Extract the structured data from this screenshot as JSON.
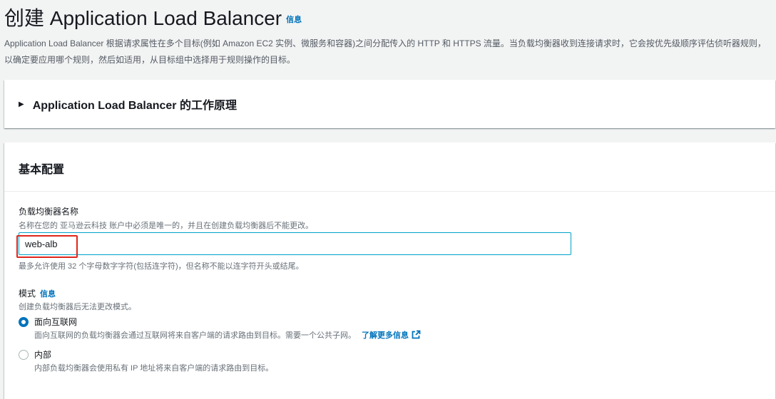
{
  "header": {
    "title": "创建 Application Load Balancer",
    "info_link": "信息",
    "description": "Application Load Balancer 根据请求属性在多个目标(例如 Amazon EC2 实例、微服务和容器)之间分配传入的 HTTP 和 HTTPS 流量。当负载均衡器收到连接请求时，它会按优先级顺序评估侦听器规则，以确定要应用哪个规则，然后如适用，从目标组中选择用于规则操作的目标。"
  },
  "how_it_works": {
    "title": "Application Load Balancer 的工作原理",
    "caret_icon": "caret-right-icon"
  },
  "basic_config": {
    "title": "基本配置",
    "name_field": {
      "label": "负载均衡器名称",
      "description": "名称在您的 亚马逊云科技 账户中必须是唯一的，并且在创建负载均衡器后不能更改。",
      "value": "web-alb",
      "constraint": "最多允许使用 32 个字母数字字符(包括连字符)，但名称不能以连字符开头或结尾。",
      "highlight_color": "#e0261b"
    },
    "scheme": {
      "label": "模式",
      "info_link": "信息",
      "description": "创建负载均衡器后无法更改模式。",
      "options": [
        {
          "label": "面向互联网",
          "description": "面向互联网的负载均衡器会通过互联网将来自客户端的请求路由到目标。需要一个公共子网。",
          "learn_more": "了解更多信息",
          "selected": true
        },
        {
          "label": "内部",
          "description": "内部负载均衡器会使用私有 IP 地址将来自客户端的请求路由到目标。",
          "selected": false
        }
      ]
    }
  },
  "colors": {
    "link": "#0073bb",
    "focus_border": "#00a1c9",
    "background": "#f2f3f3"
  }
}
